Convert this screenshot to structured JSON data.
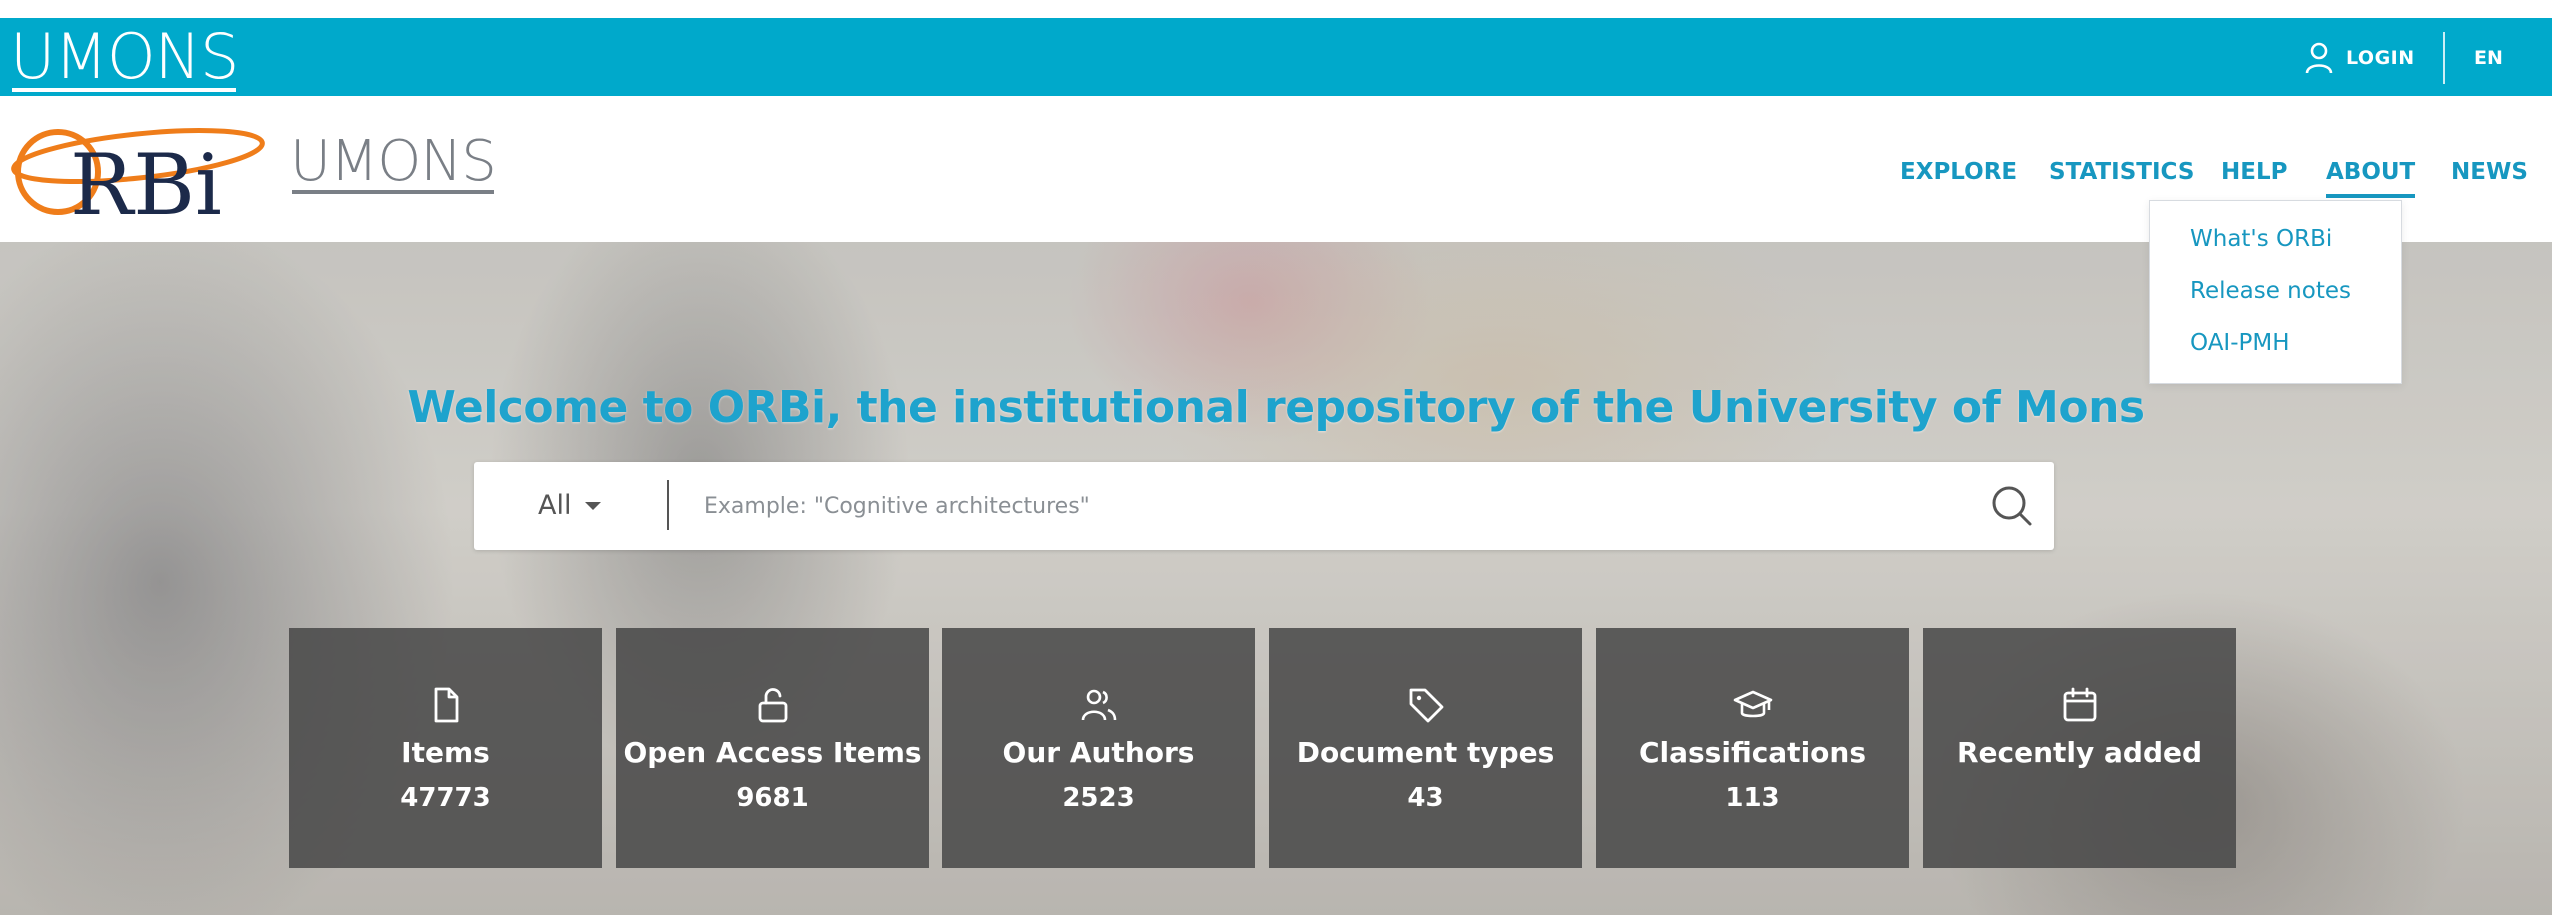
{
  "topbar": {
    "university_logo_text": "UMONS",
    "login_label": "LOGIN",
    "language": "EN"
  },
  "header": {
    "logo_text": "ORBi",
    "sub_logo_text": "UMONS",
    "nav": [
      {
        "label": "EXPLORE"
      },
      {
        "label": "STATISTICS"
      },
      {
        "label": "HELP"
      },
      {
        "label": "ABOUT",
        "active": true
      },
      {
        "label": "NEWS"
      }
    ]
  },
  "about_menu": {
    "items": [
      {
        "label": "What's ORBi"
      },
      {
        "label": "Release notes"
      },
      {
        "label": "OAI-PMH"
      }
    ]
  },
  "hero": {
    "title": "Welcome to ORBi, the institutional repository of the University of Mons"
  },
  "search": {
    "scope": "All",
    "placeholder": "Example: \"Cognitive architectures\"",
    "value": ""
  },
  "stats": [
    {
      "label": "Items",
      "value": "47773",
      "icon": "file-icon"
    },
    {
      "label": "Open Access Items",
      "value": "9681",
      "icon": "unlock-icon"
    },
    {
      "label": "Our Authors",
      "value": "2523",
      "icon": "users-icon"
    },
    {
      "label": "Document types",
      "value": "43",
      "icon": "tag-icon"
    },
    {
      "label": "Classifications",
      "value": "113",
      "icon": "graduation-cap-icon"
    },
    {
      "label": "Recently added",
      "value": "",
      "icon": "calendar-icon"
    }
  ],
  "colors": {
    "brand_blue": "#00a9cb",
    "link_blue": "#1797c0",
    "title_blue": "#1ea3cd",
    "tile_bg": "#464646"
  }
}
